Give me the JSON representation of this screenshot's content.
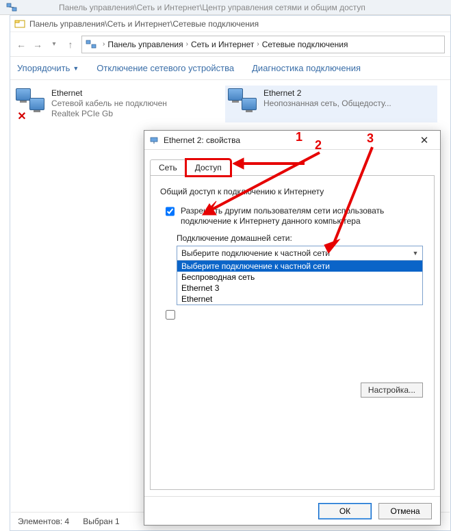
{
  "bg_bar": {
    "path": "Панель управления\\Сеть и Интернет\\Центр управления сетями и общим доступ"
  },
  "window": {
    "title": "Панель управления\\Сеть и Интернет\\Сетевые подключения",
    "breadcrumb": {
      "part1": "Панель управления",
      "part2": "Сеть и Интернет",
      "part3": "Сетевые подключения"
    },
    "toolbar": {
      "organize": "Упорядочить",
      "disable": "Отключение сетевого устройства",
      "diagnose": "Диагностика подключения"
    },
    "connections": [
      {
        "name": "Ethernet",
        "line2": "Сетевой кабель не подключен",
        "line3": "Realtek PCIe Gb",
        "selected": false,
        "error": true
      },
      {
        "name": "Ethernet 2",
        "line2": "Неопознанная сеть, Общедосту...",
        "line3": "",
        "selected": true,
        "error": false
      }
    ],
    "status": {
      "count_label": "Элементов: 4",
      "selected_label": "Выбран 1"
    }
  },
  "dialog": {
    "title": "Ethernet 2: свойства",
    "tabs": {
      "network": "Сеть",
      "access": "Доступ"
    },
    "section_title": "Общий доступ к подключению к Интернету",
    "allow_checkbox_label": "Разрешить другим пользователям сети использовать подключение к Интернету данного компьютера",
    "home_net_label": "Подключение домашней сети:",
    "combo_selected": "Выберите подключение к частной сети",
    "combo_options": [
      "Выберите подключение к частной сети",
      "Беспроводная сеть",
      "Ethernet 3",
      "Ethernet"
    ],
    "settings_button": "Настройка...",
    "ok_button": "ОК",
    "cancel_button": "Отмена"
  },
  "annotations": {
    "n1": "1",
    "n2": "2",
    "n3": "3"
  }
}
